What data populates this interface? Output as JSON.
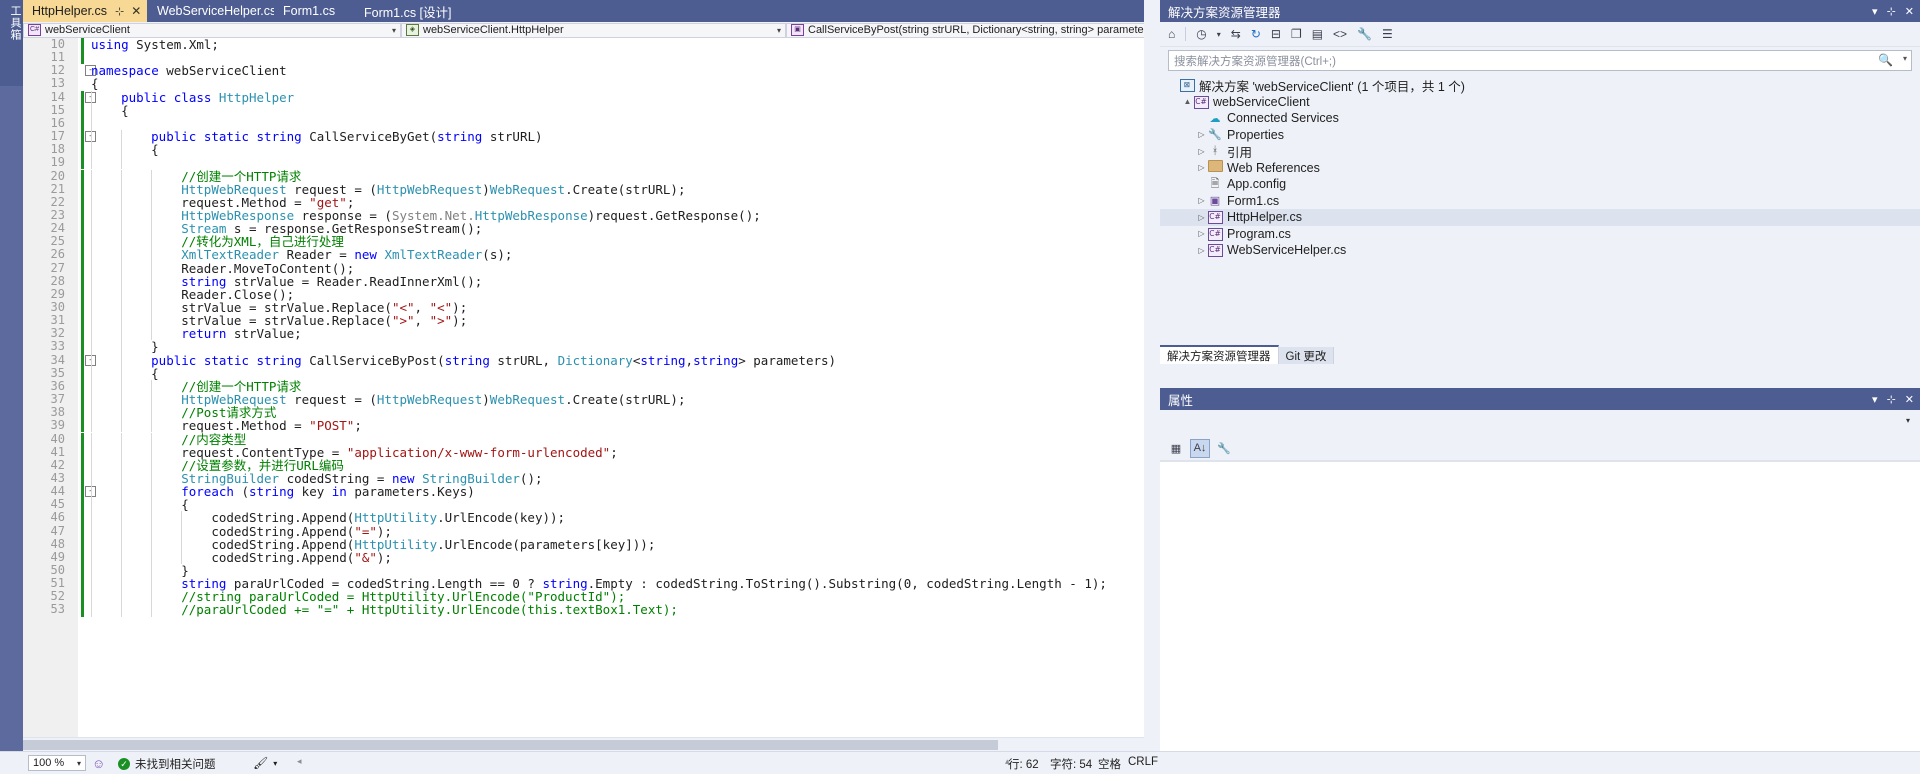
{
  "toolbox": {
    "label": "工具箱"
  },
  "tabs": [
    {
      "label": "HttpHelper.cs",
      "active": true,
      "pin": "⊹",
      "close": "✕"
    },
    {
      "label": "WebServiceHelper.cs",
      "active": false
    },
    {
      "label": "Form1.cs",
      "active": false
    },
    {
      "label": "Form1.cs [设计]",
      "active": false
    }
  ],
  "tabbar": {
    "dropdown_icon": "▾",
    "gear_icon": "⚙"
  },
  "navbar": {
    "project": "webServiceClient",
    "type": "webServiceClient.HttpHelper",
    "member": "CallServiceByPost(string strURL, Dictionary<string, string> parameters)",
    "caret": "▾",
    "split_icon": "╪"
  },
  "editor": {
    "first_line": 10,
    "lines": [
      {
        "n": 10,
        "chg": true,
        "fold": "",
        "indent": 0,
        "tokens": [
          {
            "t": "using ",
            "c": "kw"
          },
          {
            "t": "System.Xml;",
            "c": "pl"
          }
        ]
      },
      {
        "n": 11,
        "chg": true,
        "fold": "",
        "indent": 0,
        "tokens": []
      },
      {
        "n": 12,
        "chg": false,
        "fold": "-",
        "indent": 0,
        "tokens": [
          {
            "t": "namespace ",
            "c": "kw"
          },
          {
            "t": "webServiceClient",
            "c": "pl"
          }
        ]
      },
      {
        "n": 13,
        "chg": false,
        "fold": "",
        "indent": 0,
        "tokens": [
          {
            "t": "{",
            "c": "pl"
          }
        ]
      },
      {
        "n": 14,
        "chg": true,
        "fold": "-",
        "indent": 1,
        "tokens": [
          {
            "t": "public ",
            "c": "kw"
          },
          {
            "t": "class ",
            "c": "kw"
          },
          {
            "t": "HttpHelper",
            "c": "ty"
          }
        ]
      },
      {
        "n": 15,
        "chg": true,
        "fold": "",
        "indent": 1,
        "tokens": [
          {
            "t": "{",
            "c": "pl"
          }
        ]
      },
      {
        "n": 16,
        "chg": true,
        "fold": "",
        "indent": 1,
        "tokens": []
      },
      {
        "n": 17,
        "chg": true,
        "fold": "-",
        "indent": 2,
        "tokens": [
          {
            "t": "public ",
            "c": "kw"
          },
          {
            "t": "static ",
            "c": "kw"
          },
          {
            "t": "string ",
            "c": "kw"
          },
          {
            "t": "CallServiceByGet(",
            "c": "pl"
          },
          {
            "t": "string",
            "c": "kw"
          },
          {
            "t": " strURL)",
            "c": "pl"
          }
        ]
      },
      {
        "n": 18,
        "chg": true,
        "fold": "",
        "indent": 2,
        "tokens": [
          {
            "t": "{",
            "c": "pl"
          }
        ]
      },
      {
        "n": 19,
        "chg": true,
        "fold": "",
        "indent": 2,
        "tokens": []
      },
      {
        "n": 20,
        "chg": true,
        "fold": "",
        "indent": 3,
        "tokens": [
          {
            "t": "//创建一个HTTP请求",
            "c": "cm"
          }
        ]
      },
      {
        "n": 21,
        "chg": true,
        "fold": "",
        "indent": 3,
        "tokens": [
          {
            "t": "HttpWebRequest",
            "c": "ty"
          },
          {
            "t": " request = (",
            "c": "pl"
          },
          {
            "t": "HttpWebRequest",
            "c": "ty"
          },
          {
            "t": ")",
            "c": "pl"
          },
          {
            "t": "WebRequest",
            "c": "ty"
          },
          {
            "t": ".Create(strURL);",
            "c": "pl"
          }
        ]
      },
      {
        "n": 22,
        "chg": true,
        "fold": "",
        "indent": 3,
        "tokens": [
          {
            "t": "request.Method = ",
            "c": "pl"
          },
          {
            "t": "\"get\"",
            "c": "st"
          },
          {
            "t": ";",
            "c": "pl"
          }
        ]
      },
      {
        "n": 23,
        "chg": true,
        "fold": "",
        "indent": 3,
        "tokens": [
          {
            "t": "HttpWebResponse",
            "c": "ty"
          },
          {
            "t": " response = (",
            "c": "pl"
          },
          {
            "t": "System.Net.",
            "c": "gy"
          },
          {
            "t": "HttpWebResponse",
            "c": "ty"
          },
          {
            "t": ")request.GetResponse();",
            "c": "pl"
          }
        ]
      },
      {
        "n": 24,
        "chg": true,
        "fold": "",
        "indent": 3,
        "tokens": [
          {
            "t": "Stream",
            "c": "ty"
          },
          {
            "t": " s = response.GetResponseStream();",
            "c": "pl"
          }
        ]
      },
      {
        "n": 25,
        "chg": true,
        "fold": "",
        "indent": 3,
        "tokens": [
          {
            "t": "//转化为XML，自己进行处理",
            "c": "cm"
          }
        ]
      },
      {
        "n": 26,
        "chg": true,
        "fold": "",
        "indent": 3,
        "tokens": [
          {
            "t": "XmlTextReader",
            "c": "ty"
          },
          {
            "t": " Reader = ",
            "c": "pl"
          },
          {
            "t": "new ",
            "c": "kw"
          },
          {
            "t": "XmlTextReader",
            "c": "ty"
          },
          {
            "t": "(s);",
            "c": "pl"
          }
        ]
      },
      {
        "n": 27,
        "chg": true,
        "fold": "",
        "indent": 3,
        "tokens": [
          {
            "t": "Reader.MoveToContent();",
            "c": "pl"
          }
        ]
      },
      {
        "n": 28,
        "chg": true,
        "fold": "",
        "indent": 3,
        "tokens": [
          {
            "t": "string",
            "c": "kw"
          },
          {
            "t": " strValue = Reader.ReadInnerXml();",
            "c": "pl"
          }
        ]
      },
      {
        "n": 29,
        "chg": true,
        "fold": "",
        "indent": 3,
        "tokens": [
          {
            "t": "Reader.Close();",
            "c": "pl"
          }
        ]
      },
      {
        "n": 30,
        "chg": true,
        "fold": "",
        "indent": 3,
        "tokens": [
          {
            "t": "strValue = strValue.Replace(",
            "c": "pl"
          },
          {
            "t": "\"<\"",
            "c": "st"
          },
          {
            "t": ", ",
            "c": "pl"
          },
          {
            "t": "\"<\"",
            "c": "st"
          },
          {
            "t": ");",
            "c": "pl"
          }
        ]
      },
      {
        "n": 31,
        "chg": true,
        "fold": "",
        "indent": 3,
        "tokens": [
          {
            "t": "strValue = strValue.Replace(",
            "c": "pl"
          },
          {
            "t": "\">\"",
            "c": "st"
          },
          {
            "t": ", ",
            "c": "pl"
          },
          {
            "t": "\">\"",
            "c": "st"
          },
          {
            "t": ");",
            "c": "pl"
          }
        ]
      },
      {
        "n": 32,
        "chg": true,
        "fold": "",
        "indent": 3,
        "tokens": [
          {
            "t": "return ",
            "c": "kw"
          },
          {
            "t": "strValue;",
            "c": "pl"
          }
        ]
      },
      {
        "n": 33,
        "chg": true,
        "fold": "",
        "indent": 2,
        "tokens": [
          {
            "t": "}",
            "c": "pl"
          }
        ]
      },
      {
        "n": 34,
        "chg": true,
        "fold": "-",
        "indent": 2,
        "tokens": [
          {
            "t": "public ",
            "c": "kw"
          },
          {
            "t": "static ",
            "c": "kw"
          },
          {
            "t": "string ",
            "c": "kw"
          },
          {
            "t": "CallServiceByPost(",
            "c": "pl"
          },
          {
            "t": "string",
            "c": "kw"
          },
          {
            "t": " strURL, ",
            "c": "pl"
          },
          {
            "t": "Dictionary",
            "c": "ty"
          },
          {
            "t": "<",
            "c": "pl"
          },
          {
            "t": "string",
            "c": "kw"
          },
          {
            "t": ",",
            "c": "pl"
          },
          {
            "t": "string",
            "c": "kw"
          },
          {
            "t": "> parameters)",
            "c": "pl"
          }
        ]
      },
      {
        "n": 35,
        "chg": true,
        "fold": "",
        "indent": 2,
        "tokens": [
          {
            "t": "{",
            "c": "pl"
          }
        ]
      },
      {
        "n": 36,
        "chg": true,
        "fold": "",
        "indent": 3,
        "tokens": [
          {
            "t": "//创建一个HTTP请求",
            "c": "cm"
          }
        ]
      },
      {
        "n": 37,
        "chg": true,
        "fold": "",
        "indent": 3,
        "tokens": [
          {
            "t": "HttpWebRequest",
            "c": "ty"
          },
          {
            "t": " request = (",
            "c": "pl"
          },
          {
            "t": "HttpWebRequest",
            "c": "ty"
          },
          {
            "t": ")",
            "c": "pl"
          },
          {
            "t": "WebRequest",
            "c": "ty"
          },
          {
            "t": ".Create(strURL);",
            "c": "pl"
          }
        ]
      },
      {
        "n": 38,
        "chg": true,
        "fold": "",
        "indent": 3,
        "tokens": [
          {
            "t": "//Post请求方式",
            "c": "cm"
          }
        ]
      },
      {
        "n": 39,
        "chg": true,
        "fold": "",
        "indent": 3,
        "tokens": [
          {
            "t": "request.Method = ",
            "c": "pl"
          },
          {
            "t": "\"POST\"",
            "c": "st"
          },
          {
            "t": ";",
            "c": "pl"
          }
        ]
      },
      {
        "n": 40,
        "chg": true,
        "fold": "",
        "indent": 3,
        "tokens": [
          {
            "t": "//内容类型",
            "c": "cm"
          }
        ]
      },
      {
        "n": 41,
        "chg": true,
        "fold": "",
        "indent": 3,
        "tokens": [
          {
            "t": "request.ContentType = ",
            "c": "pl"
          },
          {
            "t": "\"application/x-www-form-urlencoded\"",
            "c": "st"
          },
          {
            "t": ";",
            "c": "pl"
          }
        ]
      },
      {
        "n": 42,
        "chg": true,
        "fold": "",
        "indent": 3,
        "tokens": [
          {
            "t": "//设置参数，并进行URL编码",
            "c": "cm"
          }
        ]
      },
      {
        "n": 43,
        "chg": true,
        "fold": "",
        "indent": 3,
        "tokens": [
          {
            "t": "StringBuilder",
            "c": "ty"
          },
          {
            "t": " codedString = ",
            "c": "pl"
          },
          {
            "t": "new ",
            "c": "kw"
          },
          {
            "t": "StringBuilder",
            "c": "ty"
          },
          {
            "t": "();",
            "c": "pl"
          }
        ]
      },
      {
        "n": 44,
        "chg": true,
        "fold": "-",
        "indent": 3,
        "tokens": [
          {
            "t": "foreach ",
            "c": "kw"
          },
          {
            "t": "(",
            "c": "pl"
          },
          {
            "t": "string",
            "c": "kw"
          },
          {
            "t": " key ",
            "c": "pl"
          },
          {
            "t": "in",
            "c": "kw"
          },
          {
            "t": " parameters.Keys)",
            "c": "pl"
          }
        ]
      },
      {
        "n": 45,
        "chg": true,
        "fold": "",
        "indent": 3,
        "tokens": [
          {
            "t": "{",
            "c": "pl"
          }
        ]
      },
      {
        "n": 46,
        "chg": true,
        "fold": "",
        "indent": 4,
        "tokens": [
          {
            "t": "codedString.Append(",
            "c": "pl"
          },
          {
            "t": "HttpUtility",
            "c": "ty"
          },
          {
            "t": ".UrlEncode(key));",
            "c": "pl"
          }
        ]
      },
      {
        "n": 47,
        "chg": true,
        "fold": "",
        "indent": 4,
        "tokens": [
          {
            "t": "codedString.Append(",
            "c": "pl"
          },
          {
            "t": "\"=\"",
            "c": "st"
          },
          {
            "t": ");",
            "c": "pl"
          }
        ]
      },
      {
        "n": 48,
        "chg": true,
        "fold": "",
        "indent": 4,
        "tokens": [
          {
            "t": "codedString.Append(",
            "c": "pl"
          },
          {
            "t": "HttpUtility",
            "c": "ty"
          },
          {
            "t": ".UrlEncode(parameters[key]));",
            "c": "pl"
          }
        ]
      },
      {
        "n": 49,
        "chg": true,
        "fold": "",
        "indent": 4,
        "tokens": [
          {
            "t": "codedString.Append(",
            "c": "pl"
          },
          {
            "t": "\"&\"",
            "c": "st"
          },
          {
            "t": ");",
            "c": "pl"
          }
        ]
      },
      {
        "n": 50,
        "chg": true,
        "fold": "",
        "indent": 3,
        "tokens": [
          {
            "t": "}",
            "c": "pl"
          }
        ]
      },
      {
        "n": 51,
        "chg": true,
        "fold": "",
        "indent": 3,
        "tokens": [
          {
            "t": "string",
            "c": "kw"
          },
          {
            "t": " paraUrlCoded = codedString.Length == 0 ? ",
            "c": "pl"
          },
          {
            "t": "string",
            "c": "kw"
          },
          {
            "t": ".Empty : codedString.ToString().Substring(0, codedString.Length - 1);",
            "c": "pl"
          }
        ]
      },
      {
        "n": 52,
        "chg": true,
        "fold": "",
        "indent": 3,
        "tokens": [
          {
            "t": "//string paraUrlCoded = HttpUtility.UrlEncode(\"ProductId\");",
            "c": "cm"
          }
        ]
      },
      {
        "n": 53,
        "chg": true,
        "fold": "",
        "indent": 3,
        "tokens": [
          {
            "t": "//paraUrlCoded += \"=\" + HttpUtility.UrlEncode(this.textBox1.Text);",
            "c": "cm"
          }
        ]
      }
    ]
  },
  "solution_explorer": {
    "title": "解决方案资源管理器",
    "window_controls": {
      "dropdown": "▾",
      "pin": "⊹",
      "close": "✕"
    },
    "toolbar_icons": [
      "home-icon",
      "history-icon",
      "dropdown-icon",
      "sync-icon",
      "refresh-icon",
      "collapse-all-icon",
      "show-all-files-icon",
      "properties-icon",
      "code-view-icon",
      "wrench-icon",
      "filter-icon"
    ],
    "search_placeholder": "搜索解决方案资源管理器(Ctrl+;)",
    "search_icon": "🔍",
    "tree": [
      {
        "depth": 0,
        "arrow": "",
        "icon": "solution",
        "label": "解决方案 'webServiceClient' (1 个项目，共 1 个)",
        "selected": false
      },
      {
        "depth": 1,
        "arrow": "▲",
        "icon": "csproj",
        "label": "webServiceClient",
        "selected": false
      },
      {
        "depth": 2,
        "arrow": "",
        "icon": "connected",
        "label": "Connected Services",
        "selected": false
      },
      {
        "depth": 2,
        "arrow": "▷",
        "icon": "wrench",
        "label": "Properties",
        "selected": false
      },
      {
        "depth": 2,
        "arrow": "▷",
        "icon": "refs",
        "label": "引用",
        "selected": false
      },
      {
        "depth": 2,
        "arrow": "▷",
        "icon": "folder",
        "label": "Web References",
        "selected": false
      },
      {
        "depth": 2,
        "arrow": "",
        "icon": "config",
        "label": "App.config",
        "selected": false
      },
      {
        "depth": 2,
        "arrow": "▷",
        "icon": "form",
        "label": "Form1.cs",
        "selected": false
      },
      {
        "depth": 2,
        "arrow": "▷",
        "icon": "cs",
        "label": "HttpHelper.cs",
        "selected": true
      },
      {
        "depth": 2,
        "arrow": "▷",
        "icon": "cs",
        "label": "Program.cs",
        "selected": false
      },
      {
        "depth": 2,
        "arrow": "▷",
        "icon": "cs",
        "label": "WebServiceHelper.cs",
        "selected": false
      }
    ],
    "footer_tabs": [
      {
        "label": "解决方案资源管理器",
        "active": true
      },
      {
        "label": "Git 更改",
        "active": false
      }
    ]
  },
  "properties_panel": {
    "title": "属性",
    "window_controls": {
      "dropdown": "▾",
      "pin": "⊹",
      "close": "✕"
    },
    "combo_value": "",
    "combo_caret": "▾",
    "toolbar_icons": [
      "categorized-icon",
      "alphabetical-icon",
      "properties-icon"
    ]
  },
  "statusbar": {
    "zoom": "100 %",
    "zoom_caret": "▾",
    "feedback_icon": "☺",
    "issues_icon": "✓",
    "issues_text": "未找到相关问题",
    "brush_icon": "🖌",
    "brush_caret": "▾",
    "back_caret": "◂",
    "line_label": "行: 62",
    "col_label": "字符: 54",
    "ins_label": "空格",
    "eol_label": "CRLF"
  },
  "colors": {
    "chrome": "#4d5c91",
    "active_tab": "#f7d894",
    "accent": "#2b91af",
    "keyword": "#0000ff",
    "string": "#a31515",
    "comment": "#008000",
    "changebar": "#1a8f23"
  }
}
